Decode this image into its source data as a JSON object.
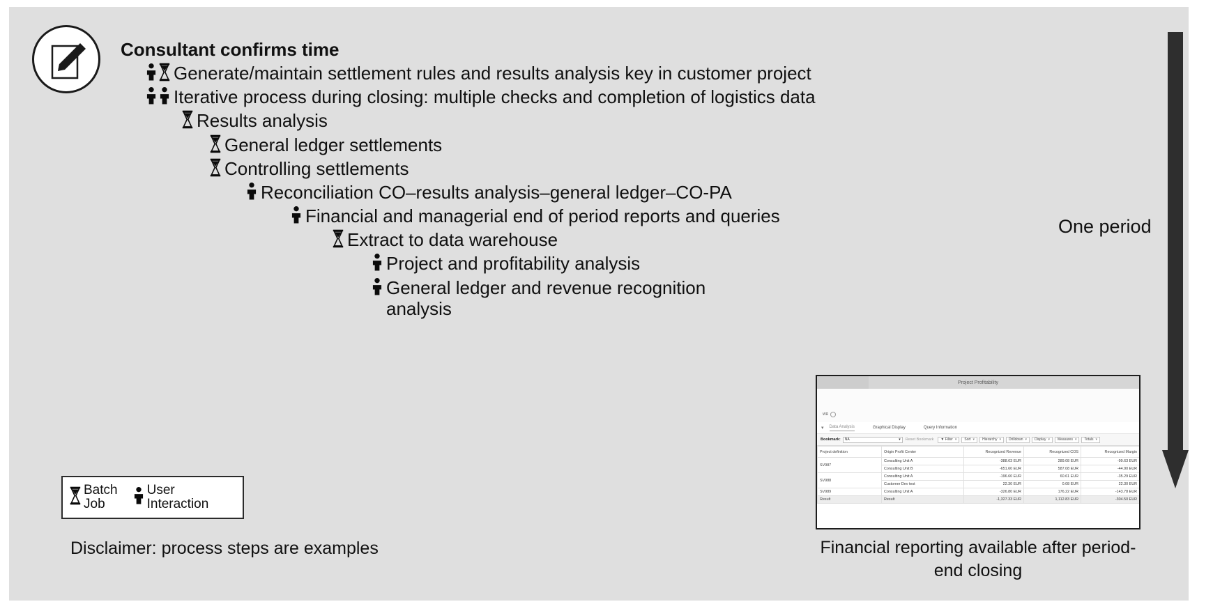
{
  "diagram": {
    "start_icon": "edit-note-icon",
    "period_label": "One period",
    "arrow": "vertical-double-arrow-down",
    "disclaimer": "Disclaimer: process steps are examples",
    "steps": [
      {
        "label": "Consultant confirms time",
        "icons": [],
        "indent": 155,
        "size": 26,
        "bold": true
      },
      {
        "label": "Generate/maintain settlement rules and results analysis key in customer project",
        "icons": [
          "user-interaction-icon",
          "batch-job-icon"
        ],
        "indent": 196,
        "size": 26,
        "bold": false
      },
      {
        "label": "Iterative process during closing: multiple checks and completion of logistics data",
        "icons": [
          "user-interaction-icon",
          "user-interaction-icon"
        ],
        "indent": 196,
        "size": 26,
        "bold": false
      },
      {
        "label": "Results analysis",
        "icons": [
          "batch-job-icon"
        ],
        "indent": 248,
        "size": 26,
        "bold": false
      },
      {
        "label": "General ledger settlements",
        "icons": [
          "batch-job-icon"
        ],
        "indent": 288,
        "size": 26,
        "bold": false
      },
      {
        "label": "Controlling settlements",
        "icons": [
          "batch-job-icon"
        ],
        "indent": 288,
        "size": 26,
        "bold": false
      },
      {
        "label": "Reconciliation CO–results analysis–general ledger–CO-PA",
        "icons": [
          "user-interaction-icon"
        ],
        "indent": 340,
        "size": 26,
        "bold": false
      },
      {
        "label": "Financial and managerial end of period reports and queries",
        "icons": [
          "user-interaction-icon"
        ],
        "indent": 404,
        "size": 26,
        "bold": false
      },
      {
        "label": "Extract to data warehouse",
        "icons": [
          "batch-job-icon"
        ],
        "indent": 464,
        "size": 26,
        "bold": false
      },
      {
        "label": "Project and profitability analysis",
        "icons": [
          "user-interaction-icon"
        ],
        "indent": 520,
        "size": 26,
        "bold": false
      },
      {
        "label": "General ledger and revenue recognition\nanalysis",
        "icons": [
          "user-interaction-icon"
        ],
        "indent": 520,
        "size": 26,
        "bold": false
      }
    ],
    "legend": [
      {
        "icon": "batch-job-icon",
        "label": "Batch\nJob"
      },
      {
        "icon": "user-interaction-icon",
        "label": "User\nInteraction"
      }
    ]
  },
  "report": {
    "caption": "Financial reporting available\nafter period-end closing",
    "title": "Project Profitability",
    "filter_name": "WR",
    "tabs": [
      {
        "label": "Data Analysis",
        "active": true
      },
      {
        "label": "Graphical Display",
        "active": false
      },
      {
        "label": "Query Information",
        "active": false
      }
    ],
    "toolbar": {
      "bookmark_label": "Bookmark:",
      "bookmark_value": "NA",
      "reset_bookmark": "Reset Bookmark",
      "buttons": [
        "Filter",
        "Sort",
        "Hierarchy",
        "Drilldown",
        "Display",
        "Measures",
        "Totals"
      ]
    },
    "table": {
      "columns": [
        "Project definition",
        "Origin Profit Center",
        "Recognized Revenue",
        "Recognized COS",
        "Recognized Margin"
      ],
      "rows": [
        {
          "project": "SV987",
          "rowspan": 2,
          "center": "Consulting Unit A",
          "revenue": "-388.63 EUR",
          "cos": "289.08 EUR",
          "margin": "-99.63 EUR"
        },
        {
          "project": "",
          "rowspan": 0,
          "center": "Consulting Unit B",
          "revenue": "-651.60 EUR",
          "cos": "587.08 EUR",
          "margin": "-44.90 EUR"
        },
        {
          "project": "SV988",
          "rowspan": 2,
          "center": "Consulting Unit A",
          "revenue": "-196.60 EUR",
          "cos": "60.61 EUR",
          "margin": "-35.29 EUR"
        },
        {
          "project": "",
          "rowspan": 0,
          "center": "Customer Dev test",
          "revenue": "22.30 EUR",
          "cos": "0.08 EUR",
          "margin": "22.30 EUR"
        },
        {
          "project": "SV989",
          "rowspan": 1,
          "center": "Consulting Unit A",
          "revenue": "-326.80 EUR",
          "cos": "176.22 EUR",
          "margin": "-143.78 EUR"
        },
        {
          "project": "Result",
          "rowspan": 1,
          "center": "Result",
          "revenue": "-1,327.33 EUR",
          "cos": "1,112.83 EUR",
          "margin": "-304.50 EUR",
          "is_result": true
        }
      ]
    }
  },
  "colors": {
    "panel_bg": "#dfdfdf",
    "text": "#101010",
    "arrow": "#2e2e2e",
    "icon_stroke": "#1a1a1a"
  }
}
